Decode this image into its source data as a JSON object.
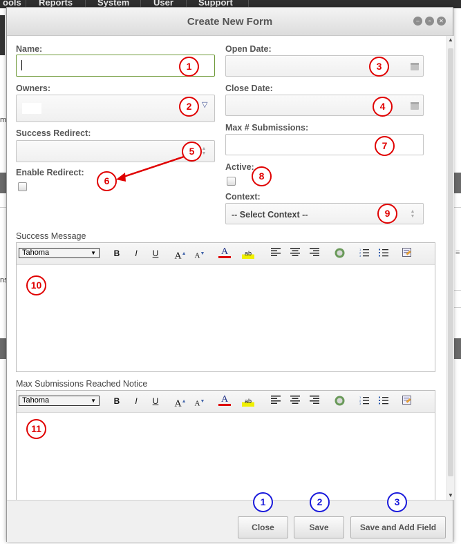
{
  "background": {
    "nav_items": [
      "ools",
      "Reports",
      "System",
      "User",
      "Support"
    ],
    "side_texts": [
      "m",
      "ns"
    ]
  },
  "dialog": {
    "title": "Create New Form",
    "window_buttons": [
      "minimize-icon",
      "restore-icon",
      "close-icon"
    ]
  },
  "form": {
    "name": {
      "label": "Name:",
      "value": ""
    },
    "owners": {
      "label": "Owners:"
    },
    "success_redirect": {
      "label": "Success Redirect:"
    },
    "enable_redirect": {
      "label": "Enable Redirect:",
      "checked": false
    },
    "open_date": {
      "label": "Open Date:",
      "value": ""
    },
    "close_date": {
      "label": "Close Date:",
      "value": ""
    },
    "max_submissions": {
      "label": "Max # Submissions:",
      "value": ""
    },
    "active": {
      "label": "Active:",
      "checked": false
    },
    "context": {
      "label": "Context:",
      "selected": "-- Select Context --"
    },
    "success_message": {
      "label": "Success Message",
      "font": "Tahoma"
    },
    "max_notice": {
      "label": "Max Submissions Reached Notice",
      "font": "Tahoma"
    }
  },
  "toolbar": {
    "bold": "B",
    "italic": "I",
    "underline": "U",
    "grow_font": "A",
    "shrink_font": "A",
    "font_color": "A",
    "highlight": "ab"
  },
  "markers": {
    "red": [
      "1",
      "2",
      "3",
      "4",
      "5",
      "6",
      "7",
      "8",
      "9",
      "10",
      "11"
    ],
    "blue": [
      "1",
      "2",
      "3"
    ]
  },
  "buttons": {
    "close": "Close",
    "save": "Save",
    "save_add": "Save and Add Field"
  },
  "colors": {
    "marker_red": "#e00000",
    "marker_blue": "#1a1adb",
    "focus_border": "#6f9a3a"
  }
}
